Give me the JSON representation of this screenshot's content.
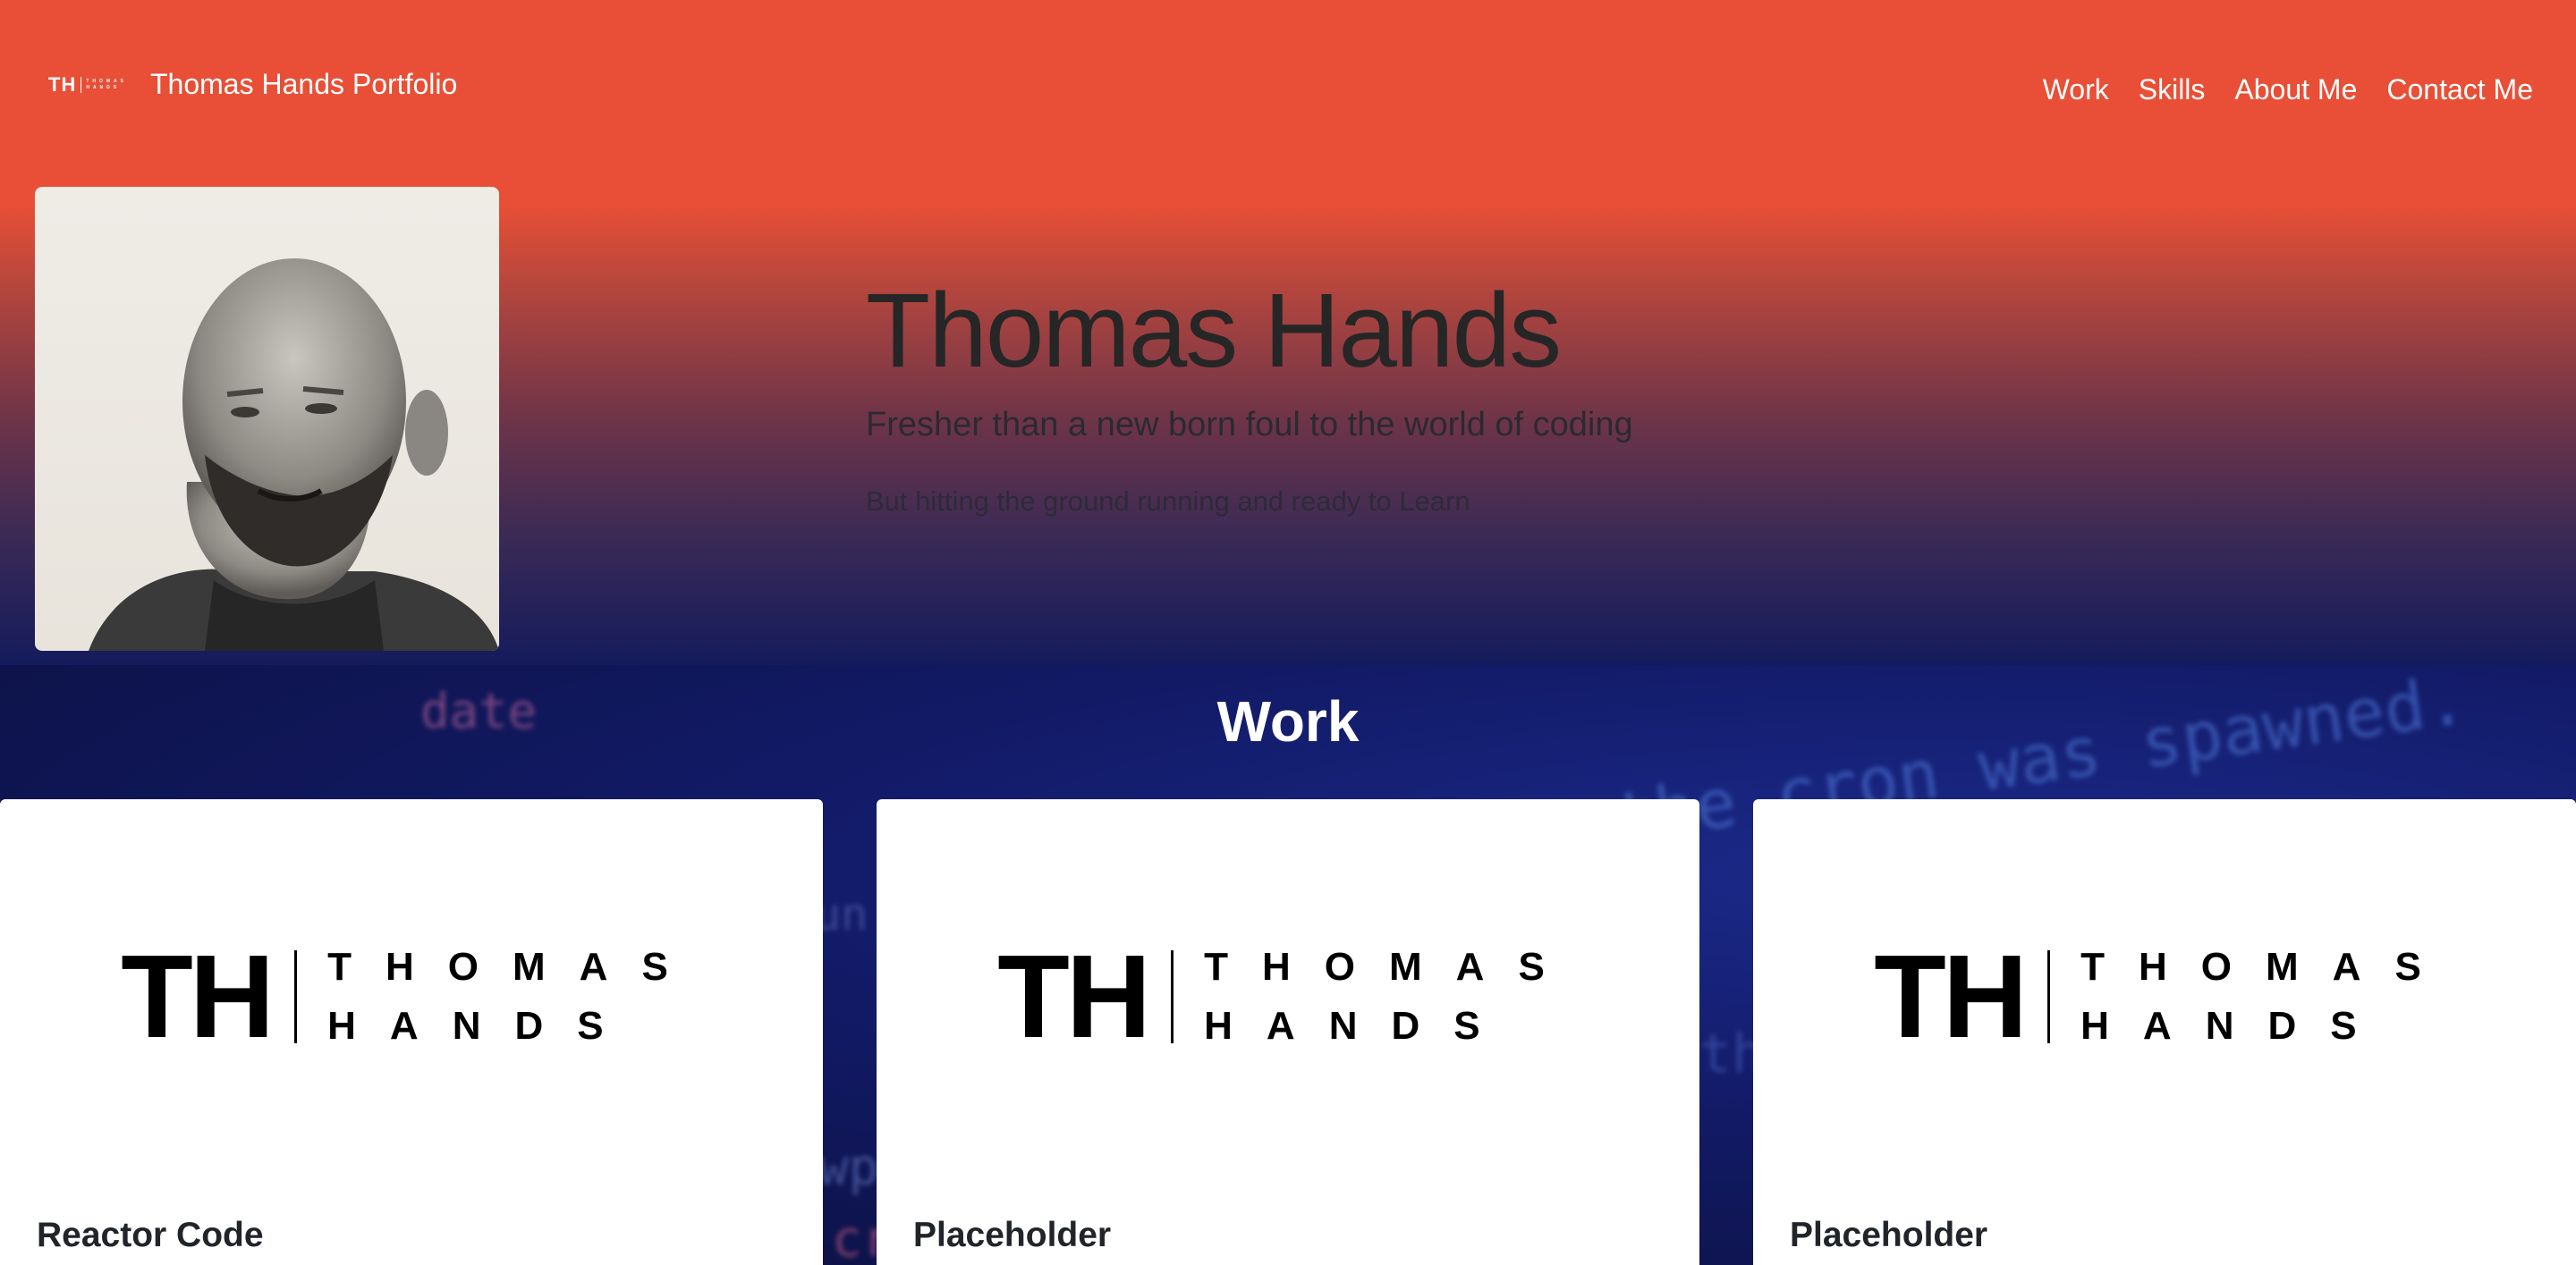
{
  "navbar": {
    "logo_mark": "TH",
    "logo_words": [
      "THOMAS",
      "HANDS"
    ],
    "brand_title": "Thomas Hands Portfolio",
    "links": [
      "Work",
      "Skills",
      "About Me",
      "Contact Me"
    ]
  },
  "hero": {
    "name": "Thomas Hands",
    "tagline": "Fresher than a new born foul to the world of coding",
    "subtext": "But hitting the ground running and ready to Learn"
  },
  "work": {
    "title": "Work",
    "background_code": [
      "date",
      "the cron was spawned.",
      "un",
      "wp",
      "cr",
      "th"
    ],
    "cards": [
      {
        "logo_mark": "TH",
        "logo_words": [
          "THOMAS",
          "HANDS"
        ],
        "title": "Reactor Code"
      },
      {
        "logo_mark": "TH",
        "logo_words": [
          "THOMAS",
          "HANDS"
        ],
        "title": "Placeholder"
      },
      {
        "logo_mark": "TH",
        "logo_words": [
          "THOMAS",
          "HANDS"
        ],
        "title": "Placeholder"
      }
    ]
  },
  "colors": {
    "hero_top": "#e84f36",
    "hero_bottom": "#141b5c",
    "work_bg": "#121a66",
    "card_bg": "#ffffff"
  }
}
